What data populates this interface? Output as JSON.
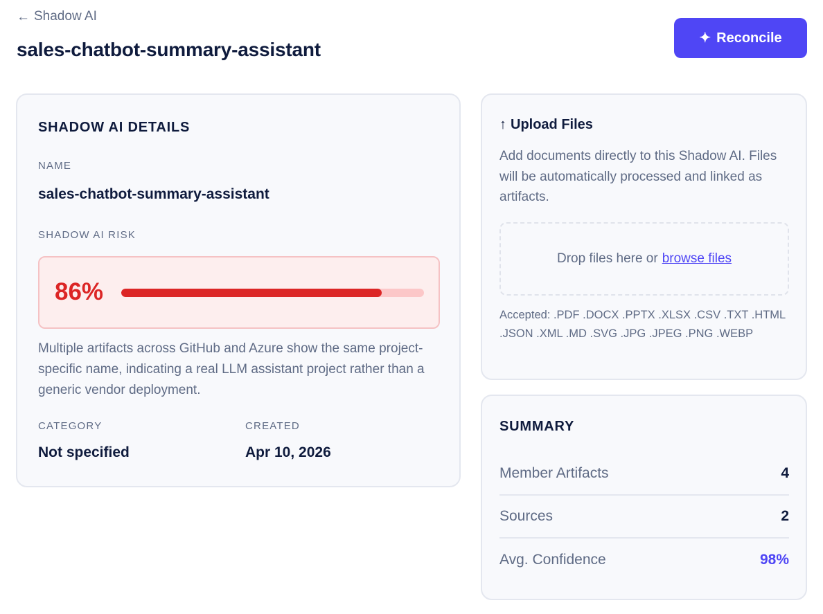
{
  "header": {
    "back_arrow": "←",
    "back_label": "Shadow AI",
    "title": "sales-chatbot-summary-assistant",
    "reconcile_icon": "✦",
    "reconcile_label": "Reconcile"
  },
  "details": {
    "section_title": "SHADOW AI DETAILS",
    "name_label": "NAME",
    "name_value": "sales-chatbot-summary-assistant",
    "risk_label": "SHADOW AI RISK",
    "risk_percent_text": "86%",
    "risk_fraction": 0.86,
    "risk_description": "Multiple artifacts across GitHub and Azure show the same project-specific name, indicating a real LLM assistant project rather than a generic vendor deployment.",
    "category_label": "CATEGORY",
    "category_value": "Not specified",
    "created_label": "CREATED",
    "created_value": "Apr 10, 2026"
  },
  "upload": {
    "icon": "↑",
    "title": "Upload Files",
    "description": "Add documents directly to this Shadow AI. Files will be automatically processed and linked as artifacts.",
    "drop_text": "Drop files here or",
    "browse_label": "browse files",
    "accepted": "Accepted: .PDF .DOCX .PPTX .XLSX .CSV .TXT .HTML .JSON .XML .MD .SVG .JPG .JPEG .PNG .WEBP"
  },
  "summary": {
    "section_title": "SUMMARY",
    "rows": [
      {
        "label": "Member Artifacts",
        "value": "4"
      },
      {
        "label": "Sources",
        "value": "2"
      },
      {
        "label": "Avg. Confidence",
        "value": "98%"
      }
    ]
  },
  "colors": {
    "accent": "#4f46f5",
    "risk": "#dc2626",
    "risk_track": "#fcc7c8",
    "risk_bg": "#fdeeee"
  }
}
